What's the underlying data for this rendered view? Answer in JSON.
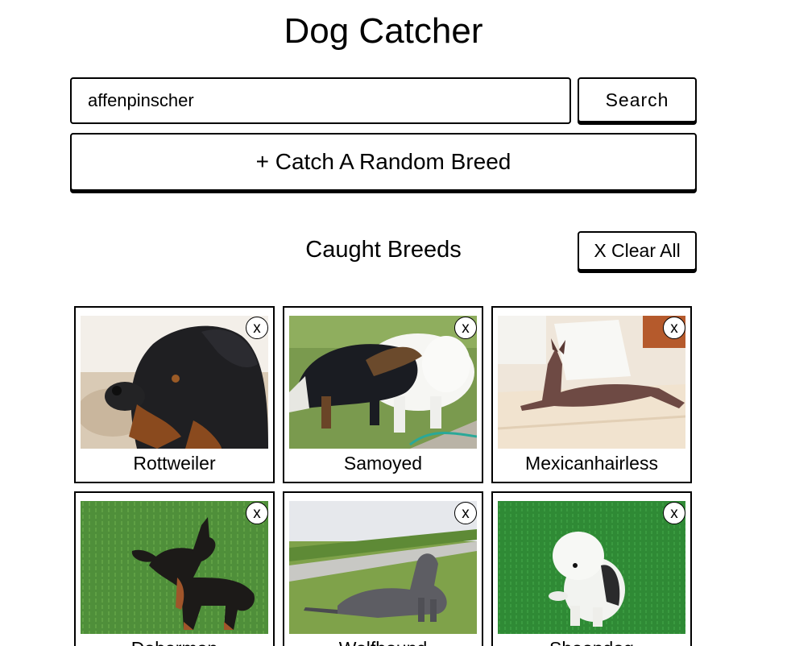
{
  "app": {
    "title": "Dog Catcher"
  },
  "search": {
    "value": "affenpinscher",
    "button_label": "Search"
  },
  "random_button_label": "+ Catch A Random Breed",
  "caught": {
    "title": "Caught Breeds",
    "clear_label": "X Clear All",
    "remove_label": "x",
    "breeds": [
      {
        "name": "Rottweiler"
      },
      {
        "name": "Samoyed"
      },
      {
        "name": "Mexicanhairless"
      },
      {
        "name": "Doberman"
      },
      {
        "name": "Wolfhound"
      },
      {
        "name": "Sheepdog"
      }
    ]
  }
}
